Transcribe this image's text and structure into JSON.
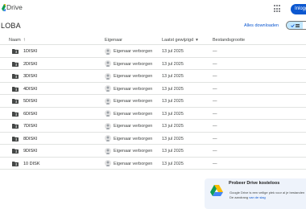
{
  "app": {
    "name": "Drive"
  },
  "header": {
    "signin_label": "Inloggen"
  },
  "folder": {
    "title": "LOBA",
    "download_all": "Alles downloaden"
  },
  "table": {
    "columns": {
      "name": "Naam",
      "owner": "Eigenaar",
      "modified": "Laatst gewijzigd",
      "size": "Bestandsgrootte"
    },
    "rows": [
      {
        "name": "1DISKI",
        "owner": "Eigenaar verborgen",
        "date": "13 jul 2025",
        "size": "—"
      },
      {
        "name": "2DISKI",
        "owner": "Eigenaar verborgen",
        "date": "13 jul 2025",
        "size": "—"
      },
      {
        "name": "3DISKI",
        "owner": "Eigenaar verborgen",
        "date": "13 jul 2025",
        "size": "—"
      },
      {
        "name": "4DISKI",
        "owner": "Eigenaar verborgen",
        "date": "13 jul 2025",
        "size": "—"
      },
      {
        "name": "5DISKI",
        "owner": "Eigenaar verborgen",
        "date": "13 jul 2025",
        "size": "—"
      },
      {
        "name": "6DISKI",
        "owner": "Eigenaar verborgen",
        "date": "13 jul 2025",
        "size": "—"
      },
      {
        "name": "7DISKI",
        "owner": "Eigenaar verborgen",
        "date": "13 jul 2025",
        "size": "—"
      },
      {
        "name": "8DISKI",
        "owner": "Eigenaar verborgen",
        "date": "13 jul 2025",
        "size": "—"
      },
      {
        "name": "9DISKI",
        "owner": "Eigenaar verborgen",
        "date": "13 jul 2025",
        "size": "—"
      },
      {
        "name": "10 DISK",
        "owner": "Eigenaar verborgen",
        "date": "13 jul 2025",
        "size": "—"
      }
    ]
  },
  "promo": {
    "title": "Probeer Drive kosteloos",
    "line1": "Google Drive is een veilige plek voor al je bestanden",
    "line2_prefix": "De aandrang ",
    "line2_link": "van de slag"
  },
  "icons": {
    "logo": "google-drive-logo",
    "apps": "apps-grid-icon",
    "sort": "arrow-up-icon",
    "folder": "shared-folder-icon",
    "avatar": "person-avatar-icon",
    "list_view": "list-view-icon"
  },
  "colors": {
    "accent": "#0b57d0",
    "toggle_active": "#c2e7ff",
    "folder": "#444746",
    "divider": "#e1e3e1",
    "promo_bg": "#eef3fb"
  }
}
